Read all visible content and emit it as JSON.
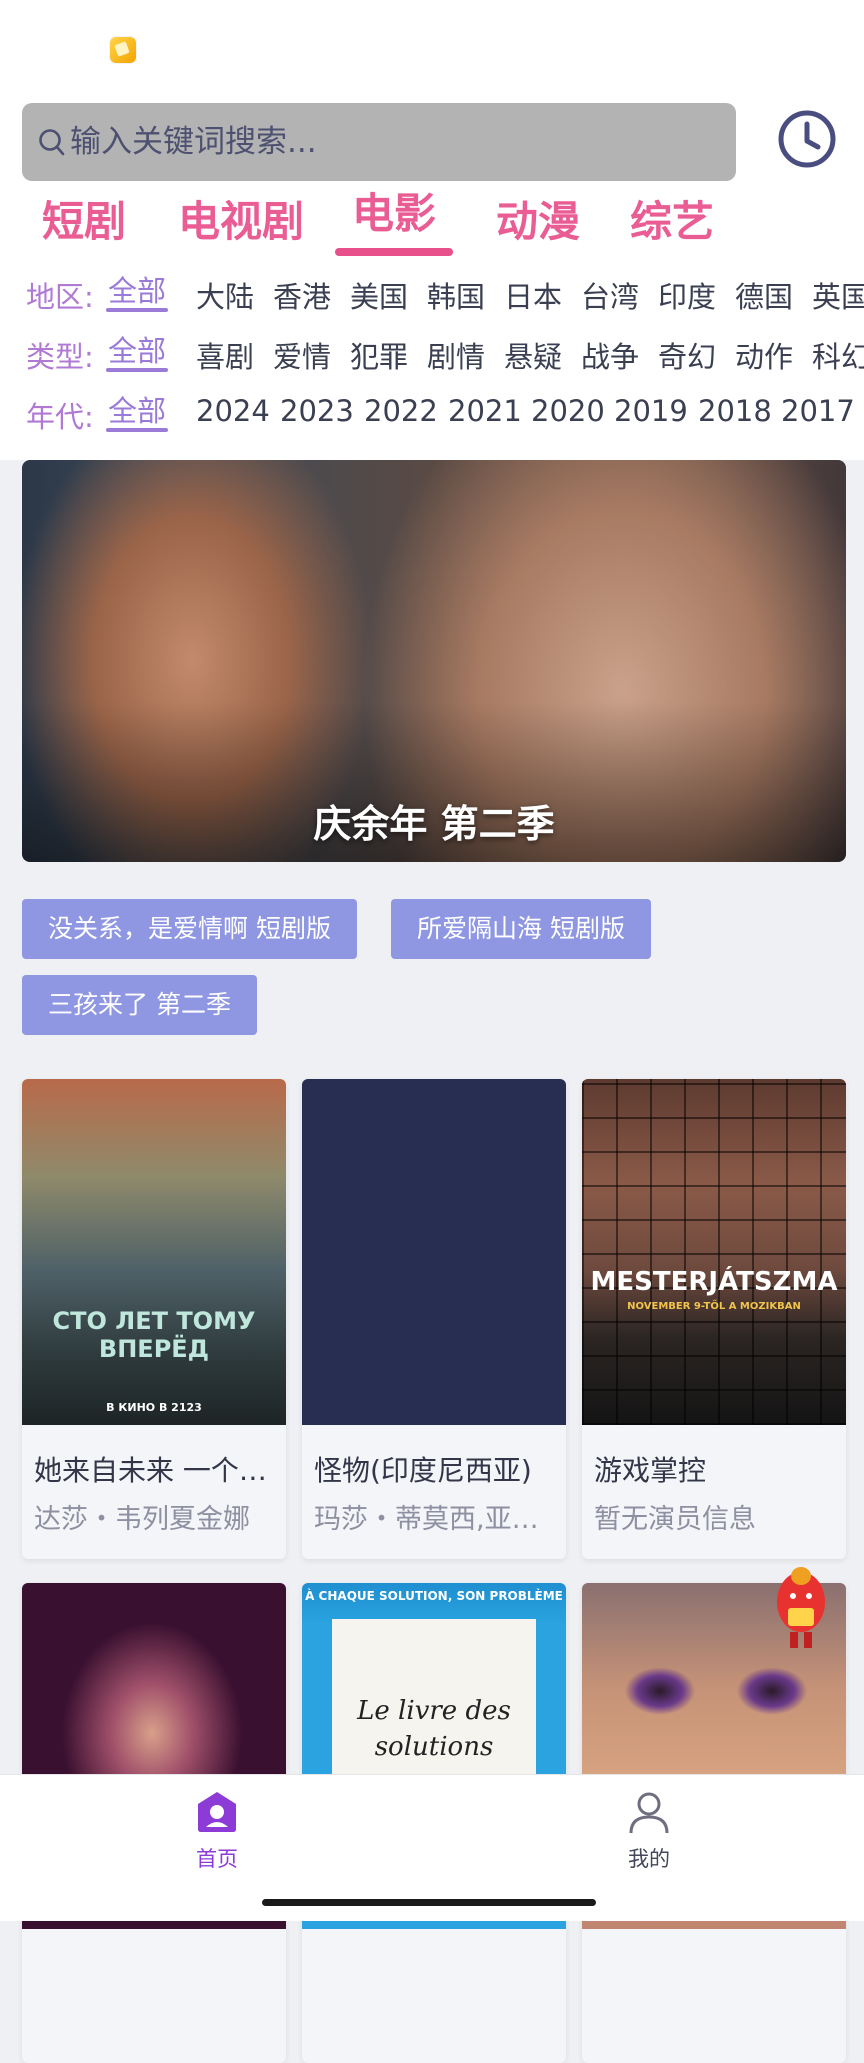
{
  "search": {
    "placeholder": "输入关键词搜索..."
  },
  "category_tabs": [
    {
      "label": "短剧",
      "active": false
    },
    {
      "label": "电视剧",
      "active": false
    },
    {
      "label": "电影",
      "active": true
    },
    {
      "label": "动漫",
      "active": false
    },
    {
      "label": "综艺",
      "active": false
    }
  ],
  "filters": {
    "region": {
      "label": "地区:",
      "selected": "全部",
      "options": [
        "大陆",
        "香港",
        "美国",
        "韩国",
        "日本",
        "台湾",
        "印度",
        "德国",
        "英国"
      ]
    },
    "genre": {
      "label": "类型:",
      "selected": "全部",
      "options": [
        "喜剧",
        "爱情",
        "犯罪",
        "剧情",
        "悬疑",
        "战争",
        "奇幻",
        "动作",
        "科幻"
      ]
    },
    "year": {
      "label": "年代:",
      "selected": "全部",
      "options": [
        "2024",
        "2023",
        "2022",
        "2021",
        "2020",
        "2019",
        "2018",
        "2017"
      ]
    }
  },
  "banner": {
    "title": "庆余年 第二季"
  },
  "quick_tags": [
    "没关系，是爱情啊 短剧版",
    "所爱隔山海 短剧版",
    "三孩来了 第二季"
  ],
  "movies": [
    {
      "title": "她来自未来 一个世纪之后",
      "cast": "达莎・韦列夏金娜",
      "poster_text": "СТО ЛЕТ ТОМУ ВПЕРЁД",
      "poster_sub": "В КИНО В 2123"
    },
    {
      "title": "怪物(印度尼西亚)",
      "cast": "玛莎・蒂莫西,亚历山德拉",
      "poster_text": "",
      "poster_sub": ""
    },
    {
      "title": "游戏掌控",
      "cast": "暂无演员信息",
      "poster_text": "MESTERJÁTSZMA",
      "poster_sub": "NOVEMBER 9-TŐL A MOZIKBAN"
    },
    {
      "title": "",
      "cast": "",
      "poster_text": "",
      "poster_sub": ""
    },
    {
      "title": "",
      "cast": "",
      "poster_text": "Le livre des solutions",
      "poster_sub": "À CHAQUE SOLUTION, SON PROBLÈME"
    },
    {
      "title": "",
      "cast": "",
      "poster_text": "",
      "poster_sub": ""
    }
  ],
  "bottom_nav": [
    {
      "label": "首页",
      "icon": "home-icon",
      "active": true
    },
    {
      "label": "我的",
      "icon": "user-icon",
      "active": false
    }
  ],
  "colors": {
    "accent_pink": "#e8508b",
    "accent_purple": "#8d3bd6",
    "chip_bg": "#8f97e2"
  }
}
